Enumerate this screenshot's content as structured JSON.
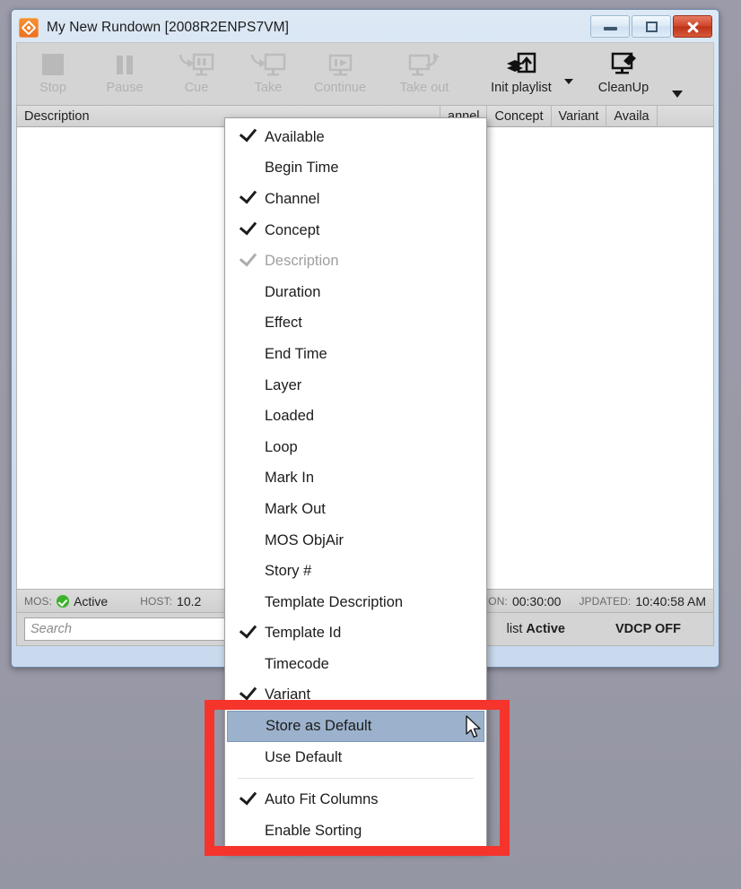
{
  "window": {
    "title": "My New Rundown [2008R2ENPS7VM]",
    "app_icon": "viz-diamond-icon",
    "buttons": {
      "minimize": "minimize-icon",
      "maximize": "maximize-icon",
      "close": "close-icon"
    }
  },
  "toolbar": {
    "items": [
      {
        "label": "Stop",
        "icon": "stop-icon",
        "enabled": false
      },
      {
        "label": "Pause",
        "icon": "pause-icon",
        "enabled": false
      },
      {
        "label": "Cue",
        "icon": "cue-icon",
        "enabled": false
      },
      {
        "label": "Take",
        "icon": "take-icon",
        "enabled": false
      },
      {
        "label": "Continue",
        "icon": "continue-icon",
        "enabled": false
      },
      {
        "label": "Take out",
        "icon": "take-out-icon",
        "enabled": false
      },
      {
        "label": "Init playlist",
        "icon": "init-playlist-icon",
        "enabled": true
      },
      {
        "label": "CleanUp",
        "icon": "cleanup-icon",
        "enabled": true
      }
    ],
    "overflow_arrow": "chevron-down-icon"
  },
  "list": {
    "columns": [
      "Description",
      "annel",
      "Concept",
      "Variant",
      "Availa"
    ],
    "rows": []
  },
  "status_bar": {
    "mos_key": "MOS:",
    "mos_value": "Active",
    "mos_indicator": "green-check-icon",
    "host_key": "HOST:",
    "host_value": "10.2",
    "duration_key": "ION:",
    "duration_value": "00:30:00",
    "updated_key": "JPDATED:",
    "updated_value": "10:40:58 AM"
  },
  "search_row": {
    "placeholder": "Search",
    "search_icon": "search-icon",
    "playlist_status_prefix": "list",
    "playlist_status_value": "Active",
    "vdcp": "VDCP OFF"
  },
  "context_menu": {
    "items": [
      {
        "label": "Available",
        "checked": true,
        "disabled": false
      },
      {
        "label": "Begin Time",
        "checked": false,
        "disabled": false
      },
      {
        "label": "Channel",
        "checked": true,
        "disabled": false
      },
      {
        "label": "Concept",
        "checked": true,
        "disabled": false
      },
      {
        "label": "Description",
        "checked": true,
        "disabled": true
      },
      {
        "label": "Duration",
        "checked": false,
        "disabled": false
      },
      {
        "label": "Effect",
        "checked": false,
        "disabled": false
      },
      {
        "label": "End Time",
        "checked": false,
        "disabled": false
      },
      {
        "label": "Layer",
        "checked": false,
        "disabled": false
      },
      {
        "label": "Loaded",
        "checked": false,
        "disabled": false
      },
      {
        "label": "Loop",
        "checked": false,
        "disabled": false
      },
      {
        "label": "Mark In",
        "checked": false,
        "disabled": false
      },
      {
        "label": "Mark Out",
        "checked": false,
        "disabled": false
      },
      {
        "label": "MOS ObjAir",
        "checked": false,
        "disabled": false
      },
      {
        "label": "Story #",
        "checked": false,
        "disabled": false
      },
      {
        "label": "Template Description",
        "checked": false,
        "disabled": false
      },
      {
        "label": "Template Id",
        "checked": true,
        "disabled": false
      },
      {
        "label": "Timecode",
        "checked": false,
        "disabled": false
      },
      {
        "label": "Variant",
        "checked": true,
        "disabled": false
      },
      {
        "label": "Store as Default",
        "checked": false,
        "disabled": false,
        "highlighted": true
      },
      {
        "label": "Use Default",
        "checked": false,
        "disabled": false
      },
      {
        "separator_before": true,
        "label": "Auto Fit Columns",
        "checked": true,
        "disabled": false
      },
      {
        "label": "Enable Sorting",
        "checked": false,
        "disabled": false
      }
    ]
  },
  "annotation": {
    "highlight_color": "#f5342c",
    "cursor": "arrow-cursor"
  },
  "colors": {
    "accent_orange": "#ec7020",
    "selection_blue": "#9cb2cc",
    "status_green": "#3cb22c",
    "toolbar_grey": "#d4d4d4",
    "desktop_grey": "#9a9aa8"
  }
}
